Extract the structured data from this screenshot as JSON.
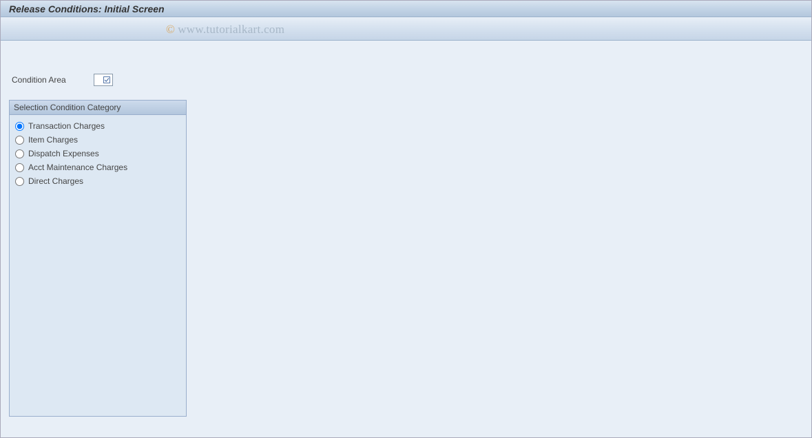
{
  "header": {
    "title": "Release Conditions: Initial Screen"
  },
  "watermark": {
    "symbol": "©",
    "text": "www.tutorialkart.com"
  },
  "form": {
    "condition_area": {
      "label": "Condition Area",
      "value": ""
    }
  },
  "group": {
    "title": "Selection Condition Category",
    "options": [
      {
        "label": "Transaction Charges",
        "selected": true
      },
      {
        "label": "Item Charges",
        "selected": false
      },
      {
        "label": "Dispatch Expenses",
        "selected": false
      },
      {
        "label": "Acct Maintenance Charges",
        "selected": false
      },
      {
        "label": "Direct Charges",
        "selected": false
      }
    ]
  }
}
